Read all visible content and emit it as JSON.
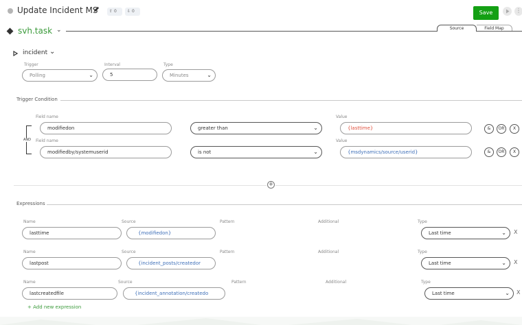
{
  "header": {
    "title": "Update Incident MS",
    "upload_count": "0",
    "download_count": "0",
    "save_label": "Save"
  },
  "task": {
    "name": "svh.task",
    "tabs": [
      {
        "label": "Source"
      },
      {
        "label": "Field Map"
      }
    ]
  },
  "entity": {
    "label": "incident"
  },
  "trigger": {
    "trigger_label": "Trigger",
    "trigger_value": "Polling",
    "interval_label": "Interval",
    "interval_value": "5",
    "type_label": "Type",
    "type_value": "Minutes"
  },
  "condition": {
    "section_title": "Trigger Condition",
    "and_label": "AND",
    "field_name_label": "Field name",
    "value_label": "Value",
    "rows": [
      {
        "field": "modifiedon",
        "operator": "greater than",
        "value": "{lasttime}"
      },
      {
        "field": "modifiedby/systemuserid",
        "operator": "is not",
        "value": "{msdynamics/source/userid}"
      }
    ],
    "amp": "&",
    "or": "OR",
    "x": "X"
  },
  "expressions": {
    "section_title": "Expressions",
    "col_name": "Name",
    "col_source": "Source",
    "col_pattern": "Pattern",
    "col_additional": "Additional",
    "col_type": "Type",
    "rows": [
      {
        "name": "lasttime",
        "source": "{modifiedon}",
        "type": "Last time"
      },
      {
        "name": "lastpost",
        "source": "{incident_posts/createdor",
        "type": "Last time"
      },
      {
        "name": "lastcreatedfile",
        "source": "{incident_annotation/createdo",
        "type": "Last time"
      }
    ],
    "remove": "X",
    "add_label": "+ Add new expression"
  },
  "colors": {
    "accent": "#3a9a3a",
    "save_bg": "#14a014",
    "link_blue": "#3e6fb8",
    "value_red": "#e0503d"
  }
}
